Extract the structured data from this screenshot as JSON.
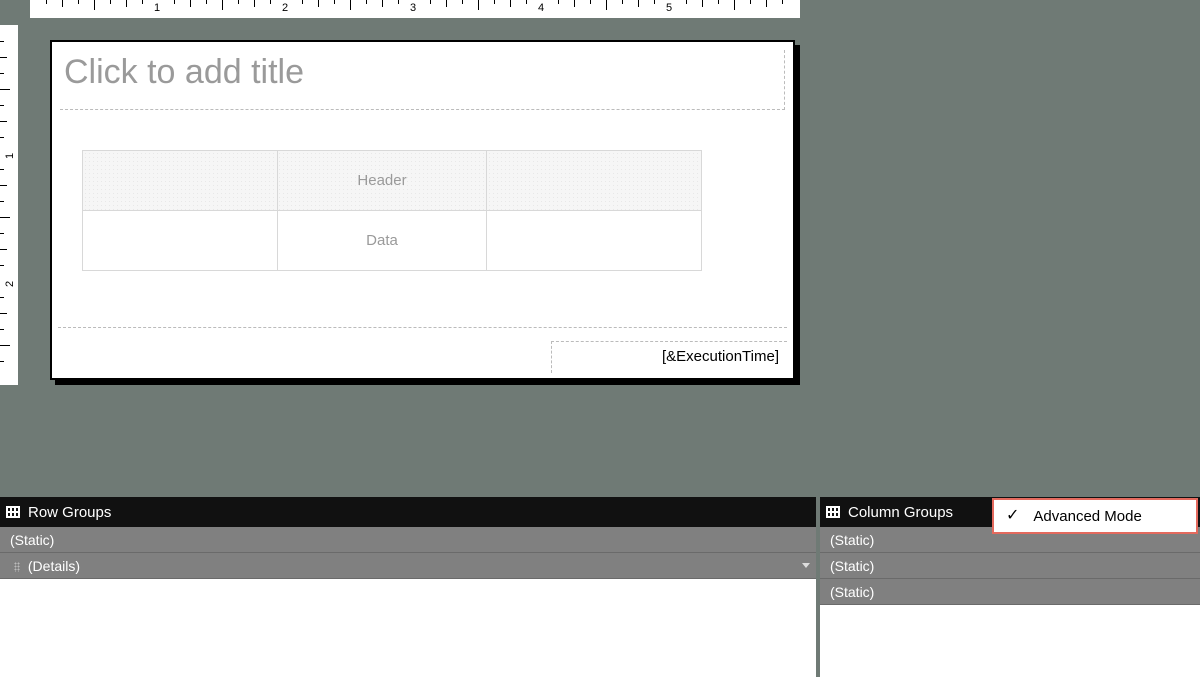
{
  "ruler": {
    "horizontal_labels": [
      "1",
      "2",
      "3",
      "4",
      "5"
    ],
    "vertical_labels": [
      "1",
      "2"
    ]
  },
  "report": {
    "title_placeholder": "Click to add title",
    "table": {
      "header_label": "Header",
      "data_label": "Data"
    },
    "footer_expression": "[&ExecutionTime]"
  },
  "grouping_pane": {
    "row_groups_title": "Row Groups",
    "column_groups_title": "Column Groups",
    "row_groups": [
      {
        "label": "(Static)"
      },
      {
        "label": "(Details)"
      }
    ],
    "column_groups": [
      {
        "label": "(Static)"
      },
      {
        "label": "(Static)"
      },
      {
        "label": "(Static)"
      }
    ]
  },
  "menu": {
    "advanced_mode_label": "Advanced Mode",
    "advanced_mode_checked": true
  }
}
